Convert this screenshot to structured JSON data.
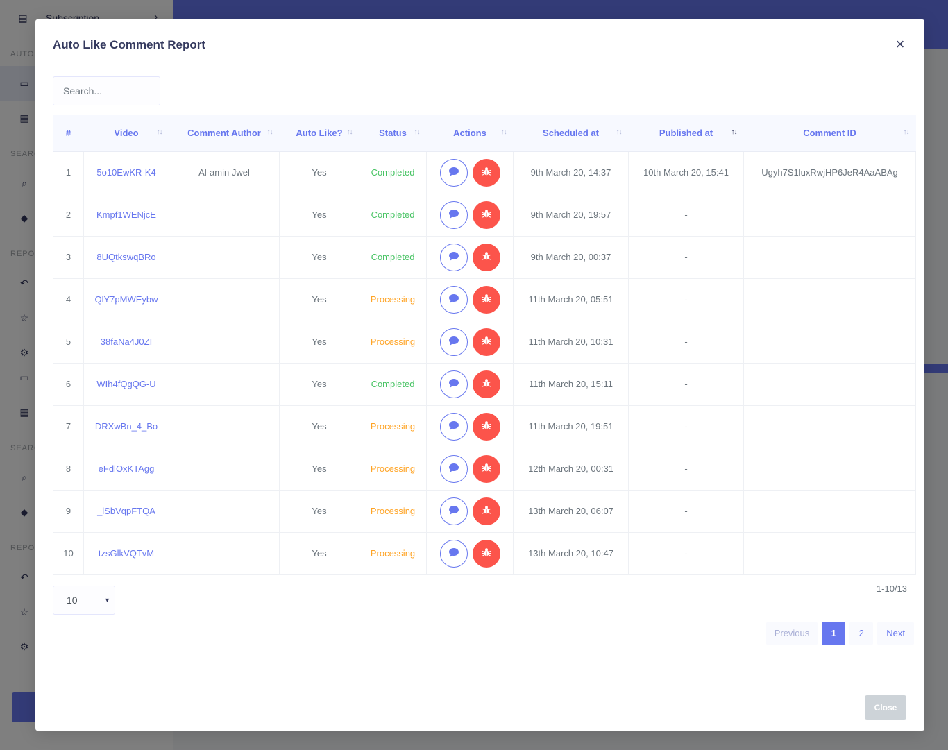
{
  "background": {
    "sidebar_item": "Subscription",
    "section_labels": [
      "AUTOMATION",
      "SEARCH",
      "REPORT",
      "SEARCH",
      "REPORT"
    ]
  },
  "modal": {
    "title": "Auto Like Comment Report",
    "close_symbol": "×",
    "search_placeholder": "Search...",
    "columns": [
      "#",
      "Video",
      "Comment Author",
      "Auto Like?",
      "Status",
      "Actions",
      "Scheduled at",
      "Published at",
      "Comment ID"
    ],
    "rows": [
      {
        "num": "1",
        "video": "5o10EwKR-K4",
        "author": "Al-amin Jwel",
        "auto_like": "Yes",
        "status": "Completed",
        "scheduled": "9th March 20, 14:37",
        "published": "10th March 20, 15:41",
        "comment_id": "Ugyh7S1luxRwjHP6JeR4AaABAg"
      },
      {
        "num": "2",
        "video": "Kmpf1WENjcE",
        "author": "",
        "auto_like": "Yes",
        "status": "Completed",
        "scheduled": "9th March 20, 19:57",
        "published": "-",
        "comment_id": ""
      },
      {
        "num": "3",
        "video": "8UQtkswqBRo",
        "author": "",
        "auto_like": "Yes",
        "status": "Completed",
        "scheduled": "9th March 20, 00:37",
        "published": "-",
        "comment_id": ""
      },
      {
        "num": "4",
        "video": "QlY7pMWEybw",
        "author": "",
        "auto_like": "Yes",
        "status": "Processing",
        "scheduled": "11th March 20, 05:51",
        "published": "-",
        "comment_id": ""
      },
      {
        "num": "5",
        "video": "38faNa4J0ZI",
        "author": "",
        "auto_like": "Yes",
        "status": "Processing",
        "scheduled": "11th March 20, 10:31",
        "published": "-",
        "comment_id": ""
      },
      {
        "num": "6",
        "video": "WIh4fQgQG-U",
        "author": "",
        "auto_like": "Yes",
        "status": "Completed",
        "scheduled": "11th March 20, 15:11",
        "published": "-",
        "comment_id": ""
      },
      {
        "num": "7",
        "video": "DRXwBn_4_Bo",
        "author": "",
        "auto_like": "Yes",
        "status": "Processing",
        "scheduled": "11th March 20, 19:51",
        "published": "-",
        "comment_id": ""
      },
      {
        "num": "8",
        "video": "eFdlOxKTAgg",
        "author": "",
        "auto_like": "Yes",
        "status": "Processing",
        "scheduled": "12th March 20, 00:31",
        "published": "-",
        "comment_id": ""
      },
      {
        "num": "9",
        "video": "_lSbVqpFTQA",
        "author": "",
        "auto_like": "Yes",
        "status": "Processing",
        "scheduled": "13th March 20, 06:07",
        "published": "-",
        "comment_id": ""
      },
      {
        "num": "10",
        "video": "tzsGlkVQTvM",
        "author": "",
        "auto_like": "Yes",
        "status": "Processing",
        "scheduled": "13th March 20, 10:47",
        "published": "-",
        "comment_id": ""
      }
    ],
    "page_size": "10",
    "range_text": "1-10/13",
    "pagination": {
      "previous": "Previous",
      "pages": [
        "1",
        "2"
      ],
      "current": "1",
      "next": "Next"
    },
    "close_button": "Close"
  },
  "colors": {
    "primary": "#6777ef",
    "danger": "#fc544b",
    "success": "#47c363",
    "warning": "#ffa426"
  }
}
